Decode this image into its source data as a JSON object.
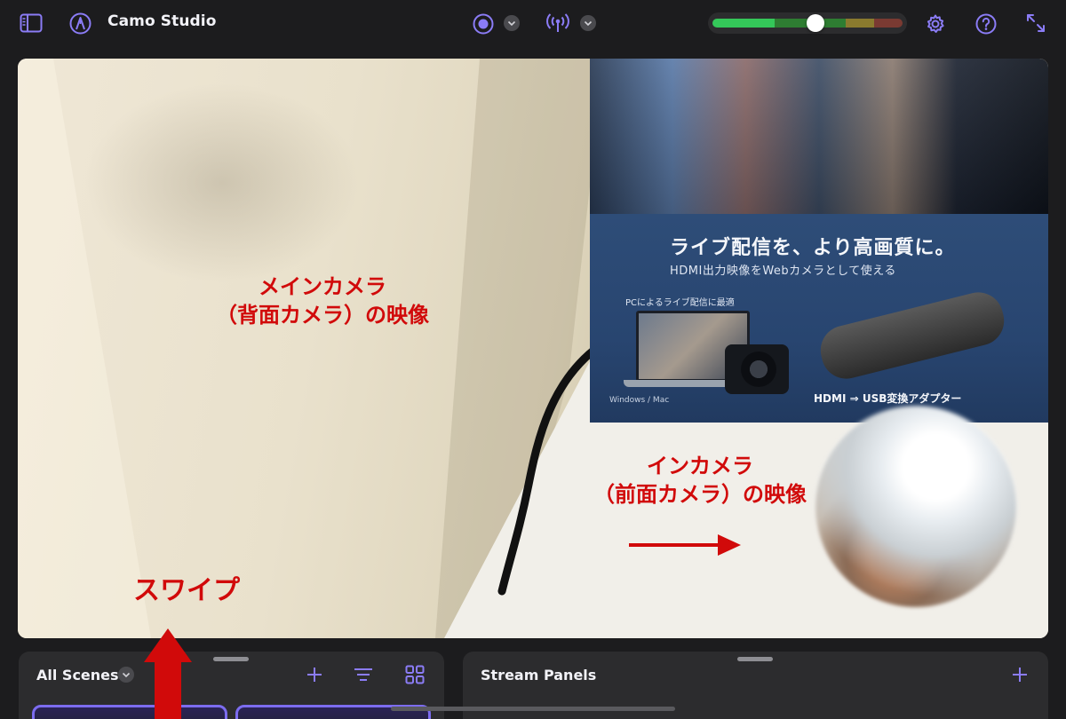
{
  "app": {
    "title": "Camo Studio",
    "accent_color": "#8b7cf6"
  },
  "toolbar": {
    "sidebar_icon": "sidebar-toggle-icon",
    "pen_icon": "markup-pen-icon",
    "record_icon": "record-icon",
    "stream_icon": "broadcast-antenna-icon",
    "settings_icon": "gear-icon",
    "help_icon": "question-mark-icon",
    "fullscreen_icon": "expand-arrows-icon"
  },
  "audio_level": {
    "value": 0.54,
    "segment_colors": [
      "#34c759",
      "#2e7d32",
      "#8a7a2e",
      "#7a3a32"
    ]
  },
  "preview": {
    "box_headline": "ライブ配信を、より高画質に。",
    "box_subline": "HDMI出力映像をWebカメラとして使える",
    "box_pc_label": "PCによるライブ配信に最適",
    "box_os_label": "Windows / Mac",
    "box_hdmi_label": "HDMI ⇒ USB変換アダプター"
  },
  "annotations": {
    "main_camera_line1": "メインカメラ",
    "main_camera_line2": "（背面カメラ）の映像",
    "front_camera_line1": "インカメラ",
    "front_camera_line2": "（前面カメラ）の映像",
    "swipe": "スワイプ",
    "color": "#d10a0a"
  },
  "scenes_panel": {
    "title": "All Scenes",
    "add_icon": "plus-icon",
    "list_icon": "list-lines-icon",
    "grid_icon": "grid-icon"
  },
  "stream_panel": {
    "title": "Stream Panels",
    "add_icon": "plus-icon"
  }
}
